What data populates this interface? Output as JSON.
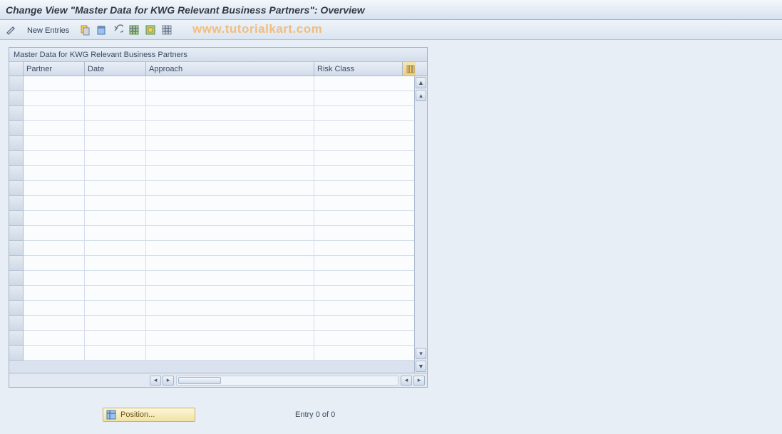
{
  "title": "Change View \"Master Data for KWG Relevant Business Partners\": Overview",
  "toolbar": {
    "new_entries_label": "New Entries"
  },
  "watermark": "www.tutorialkart.com",
  "panel": {
    "title": "Master Data for KWG Relevant Business Partners",
    "columns": {
      "partner": "Partner",
      "date": "Date",
      "approach": "Approach",
      "risk": "Risk Class"
    }
  },
  "footer": {
    "position_label": "Position...",
    "entry_text": "Entry 0 of 0"
  }
}
